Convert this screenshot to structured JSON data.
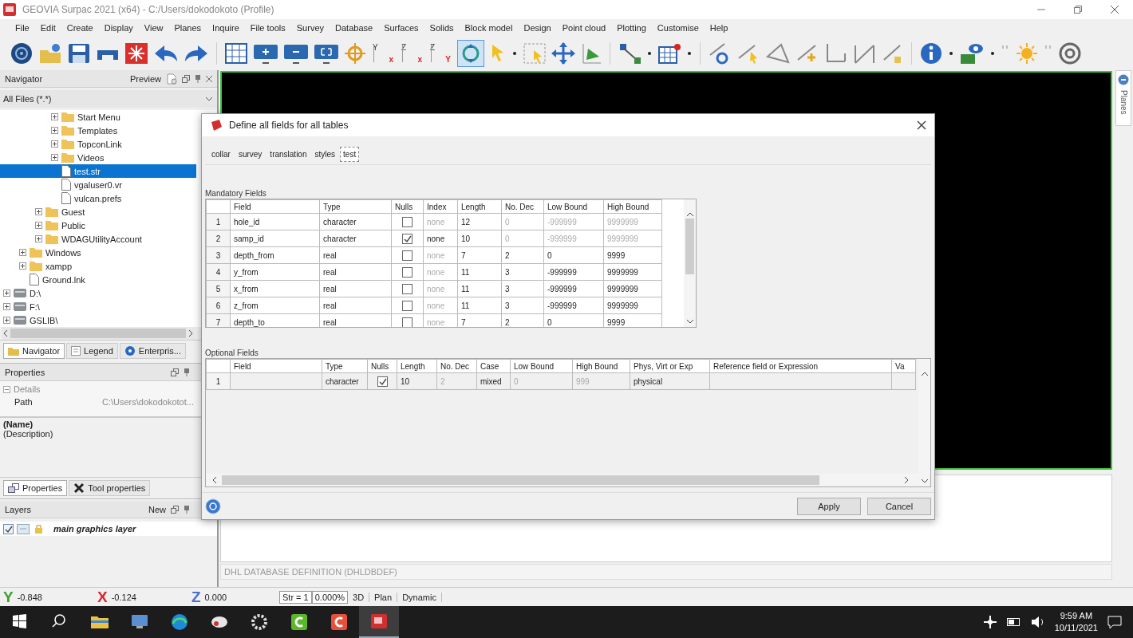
{
  "window": {
    "title": "GEOVIA Surpac 2021 (x64) - C:/Users/dokodokoto (Profile)"
  },
  "menu": [
    "File",
    "Edit",
    "Create",
    "Display",
    "View",
    "Planes",
    "Inquire",
    "File tools",
    "Survey",
    "Database",
    "Surfaces",
    "Solids",
    "Block model",
    "Design",
    "Point cloud",
    "Plotting",
    "Customise",
    "Help"
  ],
  "toolbar": {
    "rotate_selected": true,
    "view_buttons": [
      {
        "top": "Y",
        "bottom": "x"
      },
      {
        "top": "Z",
        "bottom": "x"
      },
      {
        "top": "Z",
        "bottom": "Y"
      }
    ]
  },
  "navigator": {
    "title": "Navigator",
    "preview": "Preview",
    "filter": "All Files (*.*)",
    "tree": [
      {
        "children": [
          {
            "children": [
              {
                "children": [
                  {
                    "label": "Start Menu",
                    "kind": "folder",
                    "expanded": false,
                    "selected": false
                  },
                  {
                    "label": "Templates",
                    "kind": "folder",
                    "expanded": false,
                    "selected": false
                  },
                  {
                    "label": "TopconLink",
                    "kind": "folder",
                    "expanded": false,
                    "selected": false
                  },
                  {
                    "label": "Videos",
                    "kind": "folder",
                    "expanded": false,
                    "selected": false
                  },
                  {
                    "label": "test.str",
                    "kind": "file",
                    "selected": true
                  },
                  {
                    "label": "vgaluser0.vr",
                    "kind": "file",
                    "selected": false
                  },
                  {
                    "label": "vulcan.prefs",
                    "kind": "file",
                    "selected": false
                  }
                ]
              },
              {
                "label": "Guest",
                "kind": "folder",
                "expanded": false,
                "selected": false
              },
              {
                "label": "Public",
                "kind": "folder",
                "expanded": false,
                "selected": false
              },
              {
                "label": "WDAGUtilityAccount",
                "kind": "folder",
                "expanded": false,
                "selected": false
              }
            ]
          },
          {
            "label": "Windows",
            "kind": "folder",
            "expanded": false,
            "selected": false
          },
          {
            "label": "xampp",
            "kind": "folder",
            "expanded": false,
            "selected": false
          },
          {
            "label": "Ground.lnk",
            "kind": "file",
            "selected": false
          }
        ]
      },
      {
        "label": "D:\\",
        "kind": "drive",
        "expanded": false,
        "selected": false
      },
      {
        "label": "F:\\",
        "kind": "drive",
        "expanded": false,
        "selected": false
      },
      {
        "label": "GSLIB\\",
        "kind": "drive",
        "expanded": false,
        "selected": false
      }
    ],
    "tabs": [
      {
        "label": "Navigator",
        "selected": true
      },
      {
        "label": "Legend",
        "selected": false
      },
      {
        "label": "Enterpris...",
        "selected": false
      }
    ]
  },
  "properties": {
    "title": "Properties",
    "group": "Details",
    "rows": [
      {
        "name": "Path",
        "value": "C:\\Users\\dokodokotot..."
      }
    ],
    "name_label": "(Name)",
    "description_label": "(Description)",
    "tabs": [
      {
        "label": "Properties",
        "selected": true
      },
      {
        "label": "Tool properties",
        "selected": false
      }
    ]
  },
  "layers": {
    "title": "Layers",
    "new": "New",
    "items": [
      {
        "name": "main graphics layer",
        "visible": true
      }
    ]
  },
  "planes_tab": "Planes",
  "message_panel": {
    "status": "DHL DATABASE DEFINITION (DHLDBDEF)"
  },
  "status_bar": {
    "coordinates": [
      {
        "axis": "Y",
        "value": "-0.848",
        "color": "#3aa02f"
      },
      {
        "axis": "X",
        "value": "-0.124",
        "color": "#d8262b"
      },
      {
        "axis": "Z",
        "value": "0.000",
        "color": "#4a6fd0"
      }
    ],
    "string": "Str = 1",
    "percent": "0.000%",
    "modes": [
      "3D",
      "Plan",
      "Dynamic"
    ]
  },
  "dialog": {
    "title": "Define all fields for all tables",
    "tabs": [
      {
        "label": "collar",
        "selected": false
      },
      {
        "label": "survey",
        "selected": false
      },
      {
        "label": "translation",
        "selected": false
      },
      {
        "label": "styles",
        "selected": false
      },
      {
        "label": "test",
        "selected": true
      }
    ],
    "mandatory": {
      "label": "Mandatory Fields",
      "columns": [
        {
          "label": "Field",
          "kind": "text"
        },
        {
          "label": "Type",
          "kind": "text"
        },
        {
          "label": "Nulls",
          "kind": "check"
        },
        {
          "label": "Index",
          "kind": "text"
        },
        {
          "label": "Length",
          "kind": "text"
        },
        {
          "label": "No. Dec",
          "kind": "text"
        },
        {
          "label": "Low Bound",
          "kind": "text"
        },
        {
          "label": "High Bound",
          "kind": "text"
        }
      ],
      "rows": [
        {
          "number": "1",
          "cells": [
            {
              "text": "hole_id",
              "disabled": false
            },
            {
              "text": "character",
              "disabled": false
            },
            {
              "checked": false
            },
            {
              "text": "none",
              "disabled": true
            },
            {
              "text": "12",
              "disabled": false
            },
            {
              "text": "0",
              "disabled": true
            },
            {
              "text": "-999999",
              "disabled": true
            },
            {
              "text": "9999999",
              "disabled": true
            }
          ]
        },
        {
          "number": "2",
          "cells": [
            {
              "text": "samp_id",
              "disabled": false
            },
            {
              "text": "character",
              "disabled": false
            },
            {
              "checked": true
            },
            {
              "text": "none",
              "disabled": false
            },
            {
              "text": "10",
              "disabled": false
            },
            {
              "text": "0",
              "disabled": true
            },
            {
              "text": "-999999",
              "disabled": true
            },
            {
              "text": "9999999",
              "disabled": true
            }
          ]
        },
        {
          "number": "3",
          "cells": [
            {
              "text": "depth_from",
              "disabled": false
            },
            {
              "text": "real",
              "disabled": false
            },
            {
              "checked": false
            },
            {
              "text": "none",
              "disabled": true
            },
            {
              "text": "7",
              "disabled": false
            },
            {
              "text": "2",
              "disabled": false
            },
            {
              "text": "0",
              "disabled": false
            },
            {
              "text": "9999",
              "disabled": false
            }
          ]
        },
        {
          "number": "4",
          "cells": [
            {
              "text": "y_from",
              "disabled": false
            },
            {
              "text": "real",
              "disabled": false
            },
            {
              "checked": false
            },
            {
              "text": "none",
              "disabled": true
            },
            {
              "text": "11",
              "disabled": false
            },
            {
              "text": "3",
              "disabled": false
            },
            {
              "text": "-999999",
              "disabled": false
            },
            {
              "text": "9999999",
              "disabled": false
            }
          ]
        },
        {
          "number": "5",
          "cells": [
            {
              "text": "x_from",
              "disabled": false
            },
            {
              "text": "real",
              "disabled": false
            },
            {
              "checked": false
            },
            {
              "text": "none",
              "disabled": true
            },
            {
              "text": "11",
              "disabled": false
            },
            {
              "text": "3",
              "disabled": false
            },
            {
              "text": "-999999",
              "disabled": false
            },
            {
              "text": "9999999",
              "disabled": false
            }
          ]
        },
        {
          "number": "6",
          "cells": [
            {
              "text": "z_from",
              "disabled": false
            },
            {
              "text": "real",
              "disabled": false
            },
            {
              "checked": false
            },
            {
              "text": "none",
              "disabled": true
            },
            {
              "text": "11",
              "disabled": false
            },
            {
              "text": "3",
              "disabled": false
            },
            {
              "text": "-999999",
              "disabled": false
            },
            {
              "text": "9999999",
              "disabled": false
            }
          ]
        },
        {
          "number": "7",
          "cells": [
            {
              "text": "depth_to",
              "disabled": false
            },
            {
              "text": "real",
              "disabled": false
            },
            {
              "checked": false
            },
            {
              "text": "none",
              "disabled": true
            },
            {
              "text": "7",
              "disabled": false
            },
            {
              "text": "2",
              "disabled": false
            },
            {
              "text": "0",
              "disabled": false
            },
            {
              "text": "9999",
              "disabled": false
            }
          ]
        }
      ]
    },
    "optional": {
      "label": "Optional Fields",
      "columns": [
        {
          "label": "Field",
          "kind": "text"
        },
        {
          "label": "Type",
          "kind": "text"
        },
        {
          "label": "Nulls",
          "kind": "check"
        },
        {
          "label": "Length",
          "kind": "text"
        },
        {
          "label": "No. Dec",
          "kind": "text"
        },
        {
          "label": "Case",
          "kind": "text"
        },
        {
          "label": "Low Bound",
          "kind": "text"
        },
        {
          "label": "High Bound",
          "kind": "text"
        },
        {
          "label": "Phys, Virt or Exp",
          "kind": "text"
        },
        {
          "label": "Reference field or Expression",
          "kind": "text"
        },
        {
          "label": "Va",
          "kind": "text"
        }
      ],
      "rows": [
        {
          "number": "1",
          "cells": [
            {},
            {
              "text": "character",
              "disabled": false
            },
            {
              "checked": true
            },
            {
              "text": "10",
              "disabled": false
            },
            {
              "text": "2",
              "disabled": true
            },
            {
              "text": "mixed",
              "disabled": false
            },
            {
              "text": "0",
              "disabled": true
            },
            {
              "text": "999",
              "disabled": true
            },
            {
              "text": "physical",
              "disabled": false
            },
            {},
            {}
          ]
        }
      ]
    },
    "buttons": [
      "Apply",
      "Cancel"
    ]
  },
  "taskbar": {
    "time": "9:59 AM",
    "date": "10/11/2021"
  }
}
